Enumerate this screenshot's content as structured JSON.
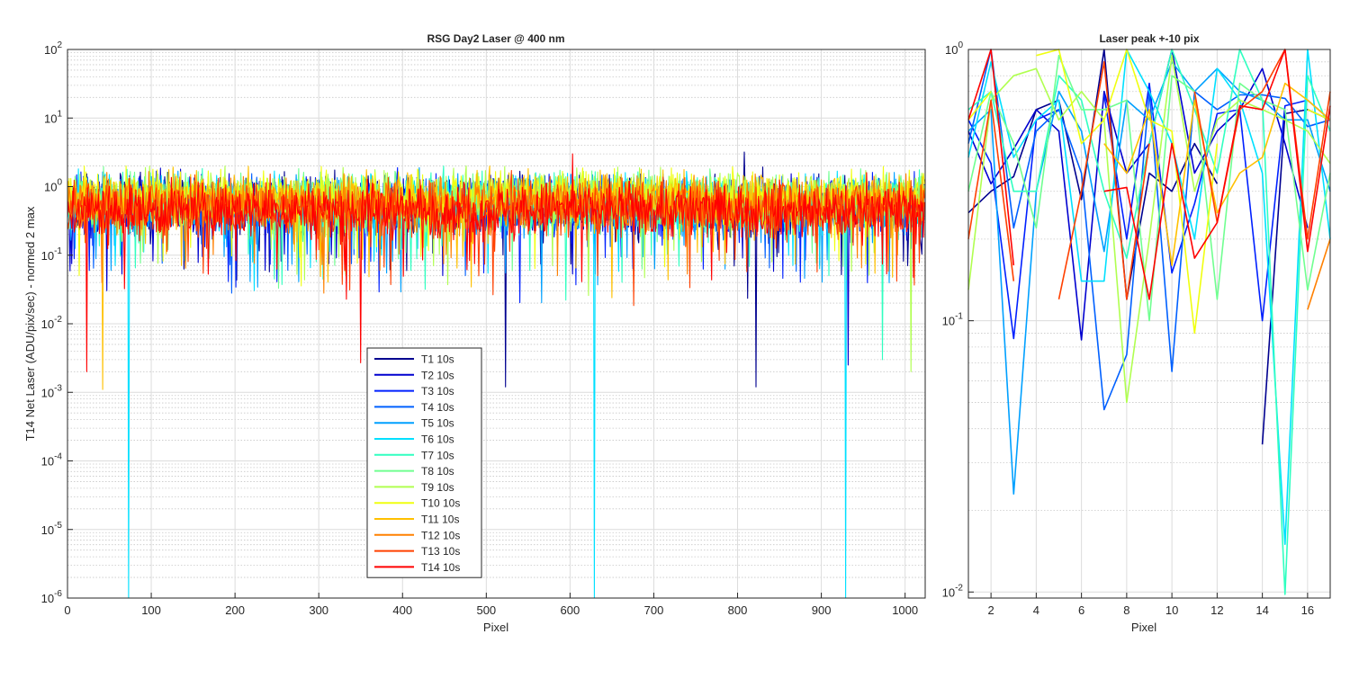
{
  "colors": {
    "T1": "#00008F",
    "T2": "#0000CF",
    "T3": "#0020FF",
    "T4": "#0060FF",
    "T5": "#00A0FF",
    "T6": "#00E0FF",
    "T7": "#30FFC0",
    "T8": "#70FF90",
    "T9": "#B0FF50",
    "T10": "#F0FF10",
    "T11": "#FFC000",
    "T12": "#FF8000",
    "T13": "#FF4000",
    "T14": "#FF0000"
  },
  "chart_data": [
    {
      "type": "line",
      "title": "RSG  Day2 Laser @ 400 nm",
      "xlabel": "Pixel",
      "ylabel": "T14 Net Laser (ADU/pix/sec) - normed 2 max",
      "xscale": "linear",
      "yscale": "log",
      "xlim": [
        0,
        1024
      ],
      "ylim": [
        1e-06,
        100
      ],
      "xticks": [
        0,
        100,
        200,
        300,
        400,
        500,
        600,
        700,
        800,
        900,
        1000
      ],
      "yticks": [
        {
          "v": 1e-06,
          "m": "10",
          "e": "-6"
        },
        {
          "v": 1e-05,
          "m": "10",
          "e": "-5"
        },
        {
          "v": 0.0001,
          "m": "10",
          "e": "-4"
        },
        {
          "v": 0.001,
          "m": "10",
          "e": "-3"
        },
        {
          "v": 0.01,
          "m": "10",
          "e": "-2"
        },
        {
          "v": 0.1,
          "m": "10",
          "e": "-1"
        },
        {
          "v": 1,
          "m": "10",
          "e": "0"
        },
        {
          "v": 10,
          "m": "10",
          "e": "1"
        },
        {
          "v": 100,
          "m": "10",
          "e": "2"
        }
      ],
      "grid": true,
      "minor_grid": true,
      "legend_position": "lower-center",
      "series_note_values": "noise-like per-pixel signal spanning roughly 0.01 to 2, with occasional spikes",
      "series": [
        {
          "name": "T1 10s",
          "color_key": "T1",
          "base": 0.55,
          "spikes": [
            [
              808,
              3.2
            ],
            [
              523,
              0.0012
            ],
            [
              822,
              0.0012
            ]
          ]
        },
        {
          "name": "T2 10s",
          "color_key": "T2",
          "base": 0.55,
          "spikes": [
            [
              932,
              0.0025
            ]
          ]
        },
        {
          "name": "T3 10s",
          "color_key": "T3",
          "base": 0.55,
          "spikes": []
        },
        {
          "name": "T4 10s",
          "color_key": "T4",
          "base": 0.55,
          "spikes": []
        },
        {
          "name": "T5 10s",
          "color_key": "T5",
          "base": 0.55,
          "spikes": []
        },
        {
          "name": "T6 10s",
          "color_key": "T6",
          "base": 0.6,
          "spikes": [
            [
              73,
              1e-06
            ],
            [
              629,
              1e-06
            ],
            [
              929,
              1e-06
            ]
          ]
        },
        {
          "name": "T7 10s",
          "color_key": "T7",
          "base": 0.6,
          "spikes": [
            [
              973,
              0.003
            ]
          ]
        },
        {
          "name": "T8 10s",
          "color_key": "T8",
          "base": 0.65,
          "spikes": []
        },
        {
          "name": "T9 10s",
          "color_key": "T9",
          "base": 0.7,
          "spikes": [
            [
              1007,
              0.002
            ]
          ]
        },
        {
          "name": "T10 10s",
          "color_key": "T10",
          "base": 0.7,
          "spikes": []
        },
        {
          "name": "T11 10s",
          "color_key": "T11",
          "base": 0.65,
          "spikes": [
            [
              42,
              0.0011
            ]
          ]
        },
        {
          "name": "T12 10s",
          "color_key": "T12",
          "base": 0.55,
          "spikes": []
        },
        {
          "name": "T13 10s",
          "color_key": "T13",
          "base": 0.5,
          "spikes": []
        },
        {
          "name": "T14 10s",
          "color_key": "T14",
          "base": 0.45,
          "spikes": [
            [
              603,
              3.0
            ],
            [
              350,
              0.0027
            ],
            [
              23,
              0.002
            ],
            [
              954,
              1.6
            ]
          ]
        }
      ]
    },
    {
      "type": "line",
      "title": "Laser peak +-10 pix",
      "xlabel": "Pixel",
      "ylabel": "",
      "xscale": "linear",
      "yscale": "log",
      "xlim": [
        1,
        17
      ],
      "ylim": [
        0.0095,
        1
      ],
      "xticks": [
        2,
        4,
        6,
        8,
        10,
        12,
        14,
        16
      ],
      "yticks": [
        {
          "v": 0.01,
          "m": "10",
          "e": "-2"
        },
        {
          "v": 0.1,
          "m": "10",
          "e": "-1"
        },
        {
          "v": 1,
          "m": "10",
          "e": "0"
        }
      ],
      "grid": true,
      "minor_grid": true,
      "x": [
        1,
        2,
        3,
        4,
        5,
        6,
        7,
        8,
        9,
        10,
        11,
        12,
        13,
        14,
        15,
        16,
        17
      ],
      "series": [
        {
          "name": "T1 10s",
          "color_key": "T1",
          "values": [
            0.25,
            0.3,
            0.34,
            0.6,
            0.65,
            0.28,
            1.0,
            0.12,
            0.35,
            0.3,
            0.45,
            0.32,
            null,
            0.035,
            0.58,
            0.6,
            0.55
          ]
        },
        {
          "name": "T2 10s",
          "color_key": "T2",
          "values": [
            0.5,
            0.32,
            0.43,
            0.6,
            0.5,
            0.085,
            0.7,
            0.35,
            0.45,
            1.0,
            0.35,
            0.5,
            0.6,
            0.85,
            0.45,
            0.22,
            null
          ]
        },
        {
          "name": "T3 10s",
          "color_key": "T3",
          "values": [
            0.55,
            0.38,
            0.086,
            0.55,
            0.6,
            null,
            0.68,
            0.2,
            0.75,
            0.15,
            0.27,
            0.58,
            0.6,
            0.1,
            0.62,
            0.65,
            0.55
          ]
        },
        {
          "name": "T4 10s",
          "color_key": "T4",
          "values": [
            0.45,
            1.0,
            0.22,
            0.5,
            0.6,
            0.35,
            0.047,
            0.075,
            0.7,
            0.065,
            0.7,
            0.6,
            0.68,
            0.68,
            0.66,
            0.52,
            0.55
          ]
        },
        {
          "name": "T5 10s",
          "color_key": "T5",
          "values": [
            0.5,
            0.6,
            0.023,
            0.3,
            0.7,
            0.5,
            0.18,
            0.65,
            0.55,
            0.9,
            0.7,
            0.85,
            0.7,
            0.65,
            0.55,
            0.55,
            0.3
          ]
        },
        {
          "name": "T6 10s",
          "color_key": "T6",
          "values": [
            0.4,
            0.9,
            0.4,
            0.55,
            0.65,
            0.14,
            0.14,
            1.0,
            0.7,
            0.45,
            0.2,
            0.85,
            0.65,
            0.35,
            0.015,
            1.0,
            0.2
          ]
        },
        {
          "name": "T7 10s",
          "color_key": "T7",
          "values": [
            0.6,
            0.7,
            0.3,
            0.3,
            0.8,
            0.65,
            0.3,
            0.17,
            0.45,
            1.0,
            0.6,
            0.35,
            1.0,
            0.65,
            0.0098,
            0.8,
            0.5
          ]
        },
        {
          "name": "T8 10s",
          "color_key": "T8",
          "values": [
            0.3,
            0.7,
            0.45,
            0.22,
            0.95,
            0.6,
            0.6,
            0.65,
            0.1,
            0.8,
            0.7,
            0.12,
            0.75,
            0.65,
            0.6,
            0.13,
            0.35
          ]
        },
        {
          "name": "T9 10s",
          "color_key": "T9",
          "values": [
            0.13,
            0.65,
            0.8,
            0.85,
            0.55,
            0.7,
            0.55,
            0.05,
            0.2,
            0.95,
            0.3,
            0.55,
            0.65,
            0.6,
            0.55,
            0.5,
            0.38
          ]
        },
        {
          "name": "T10 10s",
          "color_key": "T10",
          "values": [
            0.55,
            0.7,
            null,
            0.95,
            1.0,
            0.45,
            0.55,
            1.0,
            0.55,
            0.5,
            0.09,
            0.45,
            null,
            0.7,
            null,
            0.6,
            0.55
          ]
        },
        {
          "name": "T11 10s",
          "color_key": "T11",
          "values": [
            null,
            null,
            null,
            null,
            null,
            null,
            0.45,
            0.35,
            0.6,
            0.16,
            0.65,
            0.25,
            0.35,
            0.4,
            0.75,
            0.65,
            0.55
          ]
        },
        {
          "name": "T12 10s",
          "color_key": "T12",
          "values": [
            null,
            null,
            null,
            null,
            null,
            null,
            null,
            null,
            null,
            null,
            null,
            null,
            null,
            null,
            null,
            0.11,
            0.2
          ]
        },
        {
          "name": "T13 10s",
          "color_key": "T13",
          "values": [
            0.2,
            0.65,
            0.14,
            null,
            0.12,
            0.3,
            0.9,
            0.12,
            0.45,
            null,
            0.7,
            0.23,
            0.6,
            0.7,
            1.0,
            0.2,
            0.7
          ]
        },
        {
          "name": "T14 10s",
          "color_key": "T14",
          "values": [
            0.55,
            1.0,
            0.16,
            null,
            null,
            null,
            0.3,
            0.31,
            0.12,
            0.45,
            0.17,
            0.23,
            0.62,
            0.6,
            1.0,
            0.18,
            0.62
          ]
        }
      ]
    }
  ]
}
